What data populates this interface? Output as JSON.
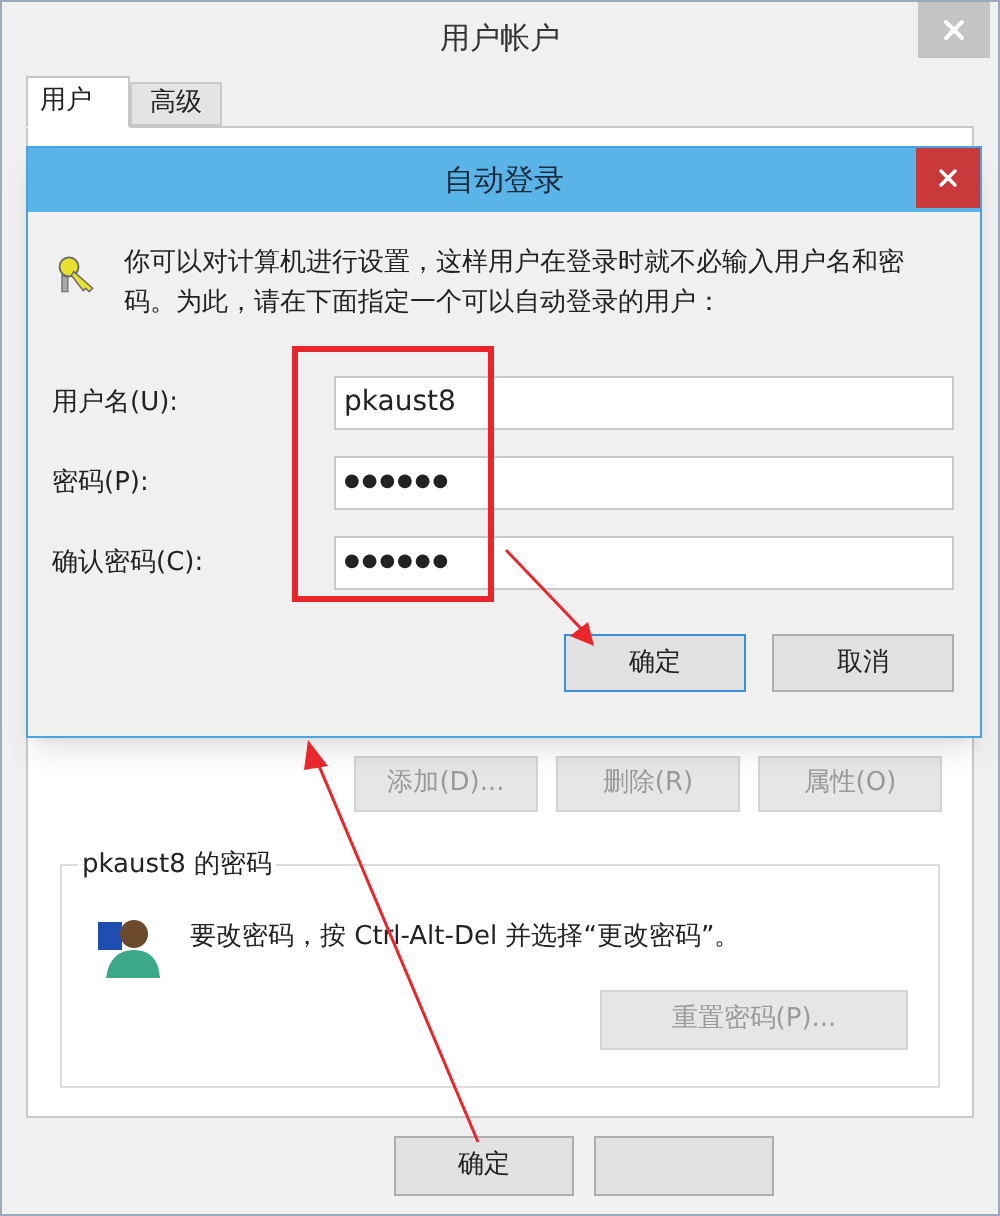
{
  "window": {
    "title": "用户帐户"
  },
  "tabs": [
    {
      "label": "用户",
      "selected": true
    },
    {
      "label": "高级",
      "selected": false
    }
  ],
  "dialog": {
    "title": "自动登录",
    "message": "你可以对计算机进行设置，这样用户在登录时就不必输入用户名和密码。为此，请在下面指定一个可以自动登录的用户：",
    "fields": [
      {
        "label": "用户名(U):",
        "value": "pkaust8",
        "kind": "text"
      },
      {
        "label": "密码(P):",
        "value": "●●●●●●",
        "kind": "password"
      },
      {
        "label": "确认密码(C):",
        "value": "●●●●●●",
        "kind": "password"
      }
    ],
    "buttons": [
      {
        "label": "确定",
        "default": true
      },
      {
        "label": "取消",
        "default": false
      }
    ]
  },
  "user_buttons": [
    {
      "label": "添加(D)...",
      "disabled": true
    },
    {
      "label": "删除(R)",
      "disabled": true
    },
    {
      "label": "属性(O)",
      "disabled": true
    }
  ],
  "password_group": {
    "title": "pkaust8 的密码",
    "message": "要改密码，按 Ctrl-Alt-Del 并选择“更改密码”。",
    "button": {
      "label": "重置密码(P)...",
      "disabled": true
    }
  },
  "footer_buttons": [
    {
      "kind": "labeled",
      "label": "确定"
    },
    {
      "kind": "blank"
    }
  ]
}
